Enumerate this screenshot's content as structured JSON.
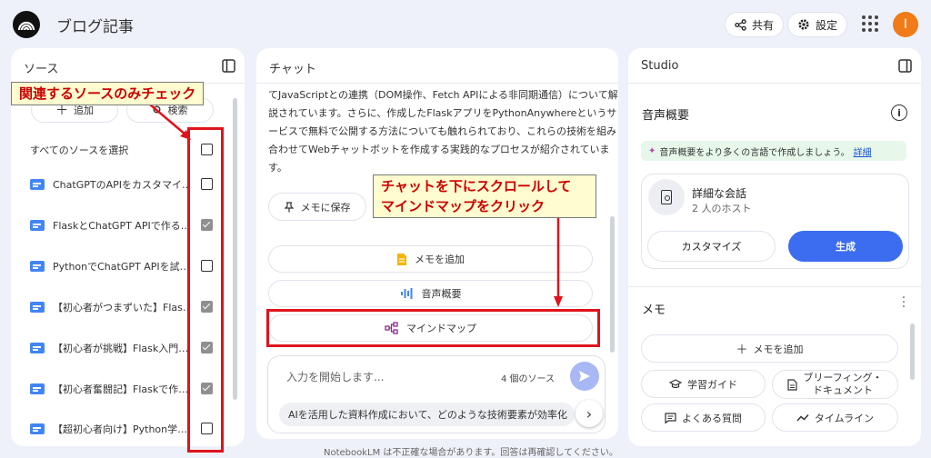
{
  "header": {
    "title": "ブログ記事",
    "share_label": "共有",
    "settings_label": "設定",
    "avatar_initial": "I"
  },
  "sources": {
    "title": "ソース",
    "add_label": "追加",
    "search_label": "検索",
    "select_all_label": "すべてのソースを選択",
    "items": [
      {
        "label": "ChatGPTのAPIをカスタマイ…",
        "checked": false
      },
      {
        "label": "FlaskとChatGPT APIで作る…",
        "checked": true
      },
      {
        "label": "PythonでChatGPT APIを試…",
        "checked": false
      },
      {
        "label": "【初心者がつまずいた】Flas…",
        "checked": true
      },
      {
        "label": "【初心者が挑戦】Flask入門…",
        "checked": true
      },
      {
        "label": "【初心者奮闘記】Flaskで作…",
        "checked": true
      },
      {
        "label": "【超初心者向け】Python学…",
        "checked": false
      }
    ]
  },
  "callouts": {
    "sources": "関連するソースのみチェック",
    "chat_line1": "チャットを下にスクロールして",
    "chat_line2": "マインドマップをクリック"
  },
  "chat": {
    "title": "チャット",
    "lines": [
      "てJavaScriptとの連携（DOM操作、Fetch APIによる非同期通信）について解",
      "説されています。さらに、作成したFlaskアプリをPythonAnywhereというサ",
      "ービスで無料で公開する方法についても触れられており、これらの技術を組み",
      "合わせてWebチャットボットを作成する実践的なプロセスが紹介されていま",
      "す。"
    ],
    "save_note_label": "メモに保存",
    "add_note_label": "メモを追加",
    "audio_overview_label": "音声概要",
    "mindmap_label": "マインドマップ",
    "input_placeholder": "入力を開始します...",
    "source_count": "4 個のソース",
    "suggestion": "AIを活用した資料作成において、どのような技術要素が効率化",
    "footer": "NotebookLM は不正確な場合があります。回答は再確認してください。"
  },
  "studio": {
    "title": "Studio",
    "audio_title": "音声概要",
    "banner_text": "音声概要をより多くの言語で作成しましょう。",
    "banner_link": "詳細",
    "convo_title": "詳細な会話",
    "convo_subtitle": "2 人のホスト",
    "customize_label": "カスタマイズ",
    "generate_label": "生成",
    "memo_title": "メモ",
    "add_memo_label": "メモを追加",
    "study_guide_label": "学習ガイド",
    "briefing_label_1": "ブリーフィング・",
    "briefing_label_2": "ドキュメント",
    "faq_label": "よくある質問",
    "timeline_label": "タイムライン"
  },
  "colors": {
    "accent": "#3c6df0",
    "highlight_red": "#e0131b",
    "callout_bg": "#fffccf",
    "avatar": "#f07b18"
  }
}
